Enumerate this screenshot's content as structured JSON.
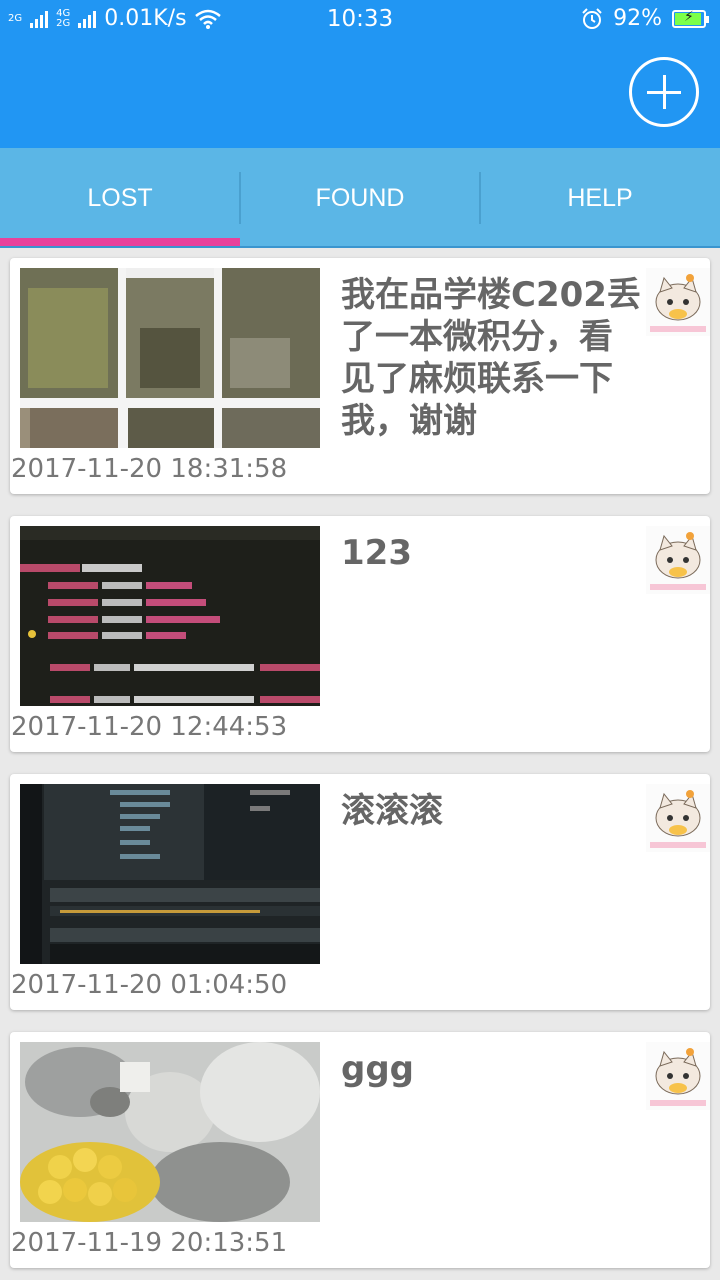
{
  "status_bar": {
    "network_1": "2G",
    "network_2a": "4G",
    "network_2b": "2G",
    "speed": "0.01K/s",
    "time": "10:33",
    "battery": "92%",
    "battery_level": 0.92
  },
  "app_bar": {
    "add_icon": "plus-circle-icon"
  },
  "tabs": [
    {
      "label": "LOST",
      "selected": true
    },
    {
      "label": "FOUND",
      "selected": false
    },
    {
      "label": "HELP",
      "selected": false
    }
  ],
  "items": [
    {
      "title": "我在品学楼C202丢了一本微积分，看见了麻烦联系一下我，谢谢",
      "time": "2017-11-20 18:31:58",
      "image": "photo-collage-trees"
    },
    {
      "title": "123",
      "time": "2017-11-20 12:44:53",
      "image": "code-screen-photo"
    },
    {
      "title": "滚滚滚",
      "time": "2017-11-20 01:04:50",
      "image": "ide-screen-photo"
    },
    {
      "title": "ggg",
      "time": "2017-11-19 20:13:51",
      "image": "food-photo-corn"
    }
  ],
  "colors": {
    "app_bar": "#2196f3",
    "tab_bar": "#5bb6e6",
    "indicator": "#e8429c",
    "title_text": "#666666",
    "time_text": "#777777"
  }
}
